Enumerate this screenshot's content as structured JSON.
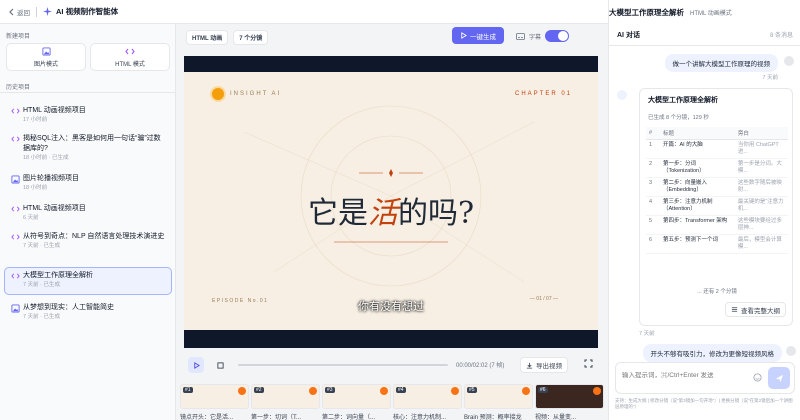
{
  "topbar": {
    "back_label": "返回",
    "app_title": "AI 视频制作智能体",
    "doc_title": "大模型工作原理全解析",
    "doc_sub": "HTML 动画模式"
  },
  "sidebar": {
    "new_title": "新建项目",
    "new_buttons": [
      {
        "label": "图片模式",
        "icon": "image-icon"
      },
      {
        "label": "HTML 模式",
        "icon": "code-icon"
      }
    ],
    "history_title": "历史项目",
    "history": [
      {
        "name": "HTML 动画视频项目",
        "meta": "17 小时前",
        "icon": "code-icon"
      },
      {
        "name": "揭秘SQL注入：黑客是如何用一句话“骗”过数据库的?",
        "meta": "18 小时前 · 已生成",
        "icon": "code-icon"
      },
      {
        "name": "图片轮播视频项目",
        "meta": "18 小时前",
        "icon": "image-icon"
      },
      {
        "name": "HTML 动画视频项目",
        "meta": "6 天前",
        "icon": "code-icon"
      },
      {
        "name": "从符号到奇点：NLP 自然语言处理技术演进史",
        "meta": "7 天前 · 已生成",
        "icon": "code-icon"
      },
      {
        "name": "大模型工作原理全解析",
        "meta": "7 天前 · 已生成",
        "icon": "code-icon",
        "active": true
      },
      {
        "name": "从梦想到现实：人工智能简史",
        "meta": "7 天前 · 已生成",
        "icon": "image-icon"
      }
    ]
  },
  "main": {
    "mode_chip": "HTML 动画",
    "count_chip": "7 个分镜",
    "generate_label": "一键生成",
    "subtitle_label": "字幕",
    "slide": {
      "brand": "INSIGHT AI",
      "chapter": "CHAPTER 01",
      "heading_pre": "它是",
      "heading_hl": "活",
      "heading_post": "的吗?",
      "episode": "EPISODE No.01",
      "pager": "— 01 / 07 —",
      "caption": "你有没有想过"
    },
    "time": "00:00/02:02",
    "time_extra": "(7 帧)",
    "export_label": "导出视频",
    "clips": [
      {
        "num": "#1",
        "label": "镜点开头：它是活..."
      },
      {
        "num": "#2",
        "label": "第一步：切词（T..."
      },
      {
        "num": "#3",
        "label": "第二步：词向量（..."
      },
      {
        "num": "#4",
        "label": "核心：注意力机制..."
      },
      {
        "num": "#5",
        "label": "Brain 预测：概率接龙"
      },
      {
        "num": "#6",
        "label": "视频：从量变..."
      }
    ]
  },
  "chat": {
    "title": "AI 对话",
    "count": "8 条消息",
    "user_msg_1": "做一个讲解大模型工作原理的视频",
    "ts_1": "7 天前",
    "card_title": "大模型工作原理全解析",
    "card_sub": "已生成 8 个分镜，129 秒",
    "table_headers": [
      "#",
      "标题",
      "旁白"
    ],
    "table_rows": [
      {
        "n": "1",
        "title": "开篇：AI 的大脑",
        "narr": "当你用 ChatGPT 进..."
      },
      {
        "n": "2",
        "title": "第一步：分词（Tokenization）",
        "narr": "第一步是分词。大模..."
      },
      {
        "n": "3",
        "title": "第二步：向量嵌入（Embedding）",
        "narr": "这些数字随后被映射..."
      },
      {
        "n": "4",
        "title": "第三步：注意力机制（Attention）",
        "narr": "最关键的是“注意力机..."
      },
      {
        "n": "5",
        "title": "第四步：Transformer 架构",
        "narr": "这些模块要经过多层神..."
      },
      {
        "n": "6",
        "title": "第五步：预测下一个词",
        "narr": "最后，模型会计算模..."
      }
    ],
    "more_label": "... 还有 2 个分镜",
    "view_label": "查看完整大纲",
    "ts_2": "7 天前",
    "user_msg_2": "开头不够有吸引力，修改为更像短视频风格",
    "input_placeholder": "输入提示词，⌘/Ctrl+Enter 发送",
    "hint": "支持：生成大纲 | 修改分镜（说“第3镜加一句开场”）| 更换分镜（说“在第2镜后加一个讲图层原理的”）"
  }
}
